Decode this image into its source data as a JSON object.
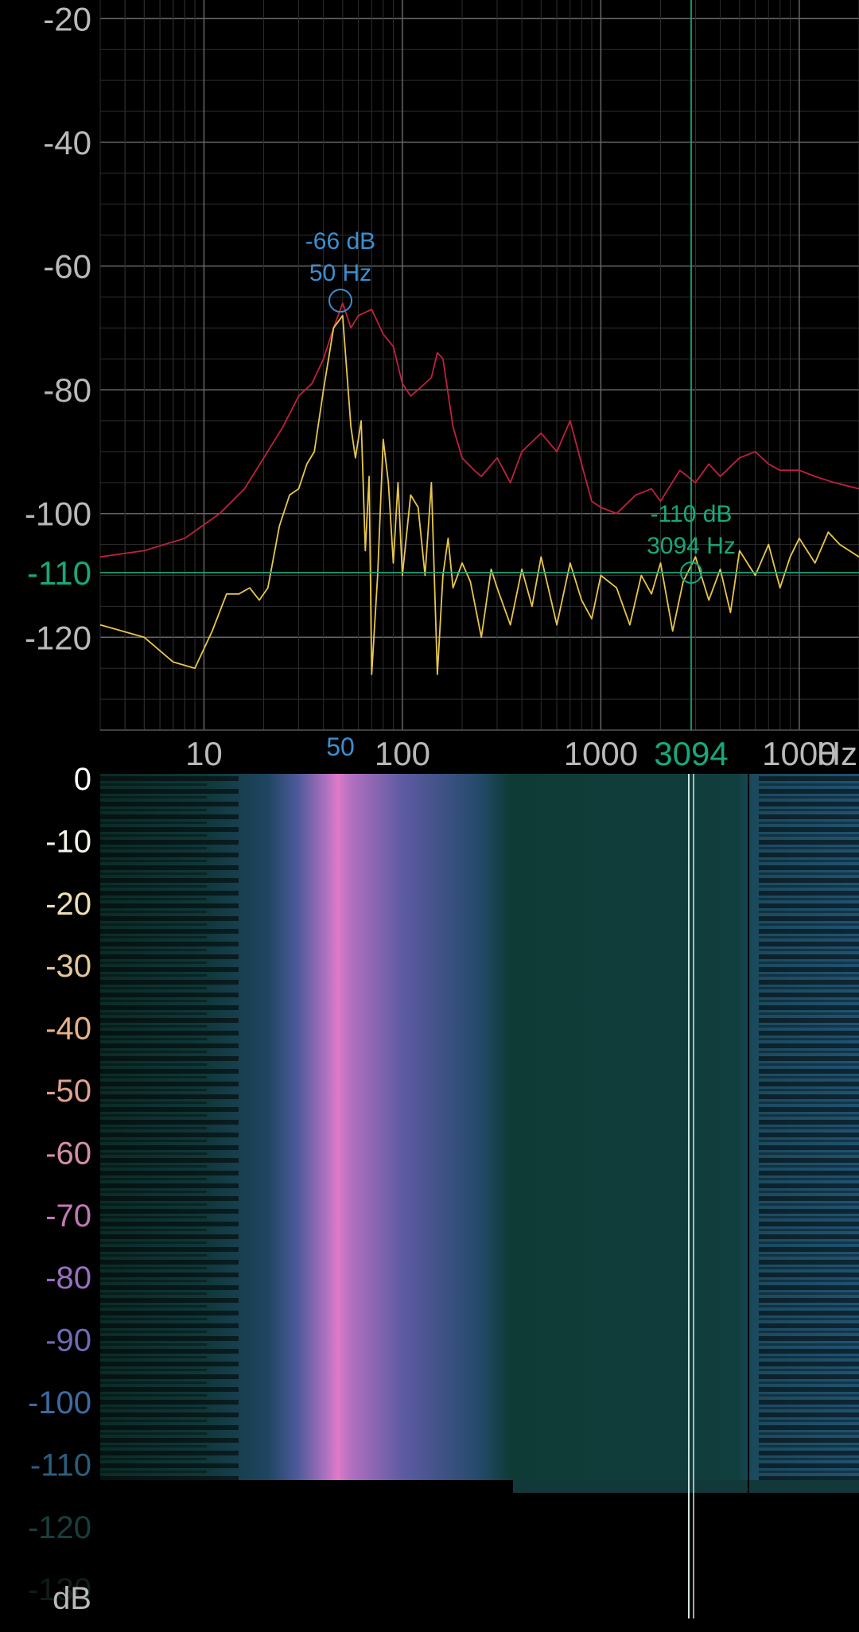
{
  "spectrum": {
    "y_ticks": [
      "-20",
      "-40",
      "-60",
      "-80",
      "-100",
      "-120"
    ],
    "x_ticks": [
      "10",
      "100",
      "1000",
      "1000"
    ],
    "x_unit": "Hz",
    "peak_marker": {
      "x_label": "50",
      "db_label": "-66 dB",
      "hz_label": "50 Hz"
    },
    "cursor": {
      "y_label": "-110",
      "x_label": "3094",
      "db_label": "-110 dB",
      "hz_label": "3094 Hz"
    }
  },
  "spectrogram": {
    "scale_labels": [
      "0",
      "-10",
      "-20",
      "-30",
      "-40",
      "-50",
      "-60",
      "-70",
      "-80",
      "-90",
      "-100",
      "-110",
      "-120",
      "-130"
    ],
    "scale_colors": [
      "#ffffff",
      "#f5f5ea",
      "#ede0b8",
      "#e4c89a",
      "#e7b28a",
      "#e0a090",
      "#d68ea8",
      "#c07ab6",
      "#9a6fc0",
      "#6f6bb6",
      "#3d6aa2",
      "#2b5d7c",
      "#173f3c",
      "#0e1e18"
    ],
    "unit": "dB"
  },
  "colors": {
    "background": "#000000",
    "grid": "#444444",
    "peak_hold_line": "#c0213e",
    "live_line": "#e8c64a",
    "cursor": "#17a87b",
    "peak_marker": "#3b8fd1"
  },
  "chart_data": {
    "type": "line",
    "x_scale": "log",
    "xlabel": "Hz",
    "ylabel": "",
    "xlim": [
      3,
      20000
    ],
    "ylim": [
      -135,
      -17
    ],
    "series": [
      {
        "x": [
          3,
          5,
          8,
          12,
          16,
          20,
          25,
          30,
          35,
          40,
          45,
          50,
          55,
          60,
          70,
          80,
          90,
          100,
          110,
          120,
          140,
          150,
          160,
          180,
          200,
          230,
          250,
          300,
          350,
          400,
          500,
          600,
          700,
          800,
          900,
          1000,
          1200,
          1500,
          1800,
          2000,
          2500,
          3000,
          3500,
          4000,
          5000,
          6000,
          7000,
          8000,
          10000,
          12000,
          15000,
          20000
        ],
        "y": [
          -107,
          -106,
          -104,
          -100,
          -96,
          -91,
          -86,
          -81,
          -79,
          -75,
          -70,
          -66,
          -70,
          -68,
          -67,
          -71,
          -73,
          -79,
          -81,
          -80,
          -78,
          -74,
          -75,
          -86,
          -91,
          -93,
          -94,
          -91,
          -95,
          -90,
          -87,
          -90,
          -85,
          -92,
          -98,
          -99,
          -100,
          -97,
          -96,
          -98,
          -93,
          -95,
          -92,
          -94,
          -91,
          -90,
          -92,
          -93,
          -93,
          -94,
          -95,
          -96
        ]
      },
      {
        "x": [
          3,
          5,
          7,
          9,
          11,
          13,
          15,
          17,
          19,
          21,
          24,
          27,
          30,
          33,
          36,
          40,
          45,
          50,
          55,
          58,
          62,
          65,
          68,
          70,
          75,
          80,
          85,
          90,
          95,
          100,
          110,
          120,
          130,
          140,
          150,
          160,
          170,
          180,
          200,
          220,
          250,
          280,
          300,
          350,
          400,
          450,
          500,
          600,
          700,
          800,
          900,
          1000,
          1200,
          1400,
          1600,
          1800,
          2000,
          2300,
          2600,
          3000,
          3500,
          4000,
          4500,
          5000,
          6000,
          7000,
          8000,
          9000,
          10000,
          12000,
          14000,
          16000,
          20000
        ],
        "y": [
          -118,
          -120,
          -124,
          -125,
          -119,
          -113,
          -113,
          -112,
          -114,
          -112,
          -102,
          -97,
          -96,
          -92,
          -90,
          -80,
          -70,
          -68,
          -86,
          -91,
          -85,
          -106,
          -94,
          -126,
          -110,
          -88,
          -95,
          -108,
          -95,
          -110,
          -97,
          -99,
          -110,
          -95,
          -126,
          -110,
          -104,
          -112,
          -108,
          -111,
          -120,
          -109,
          -112,
          -118,
          -109,
          -115,
          -107,
          -118,
          -108,
          -114,
          -117,
          -110,
          -112,
          -118,
          -110,
          -113,
          -108,
          -119,
          -111,
          -107,
          -114,
          -109,
          -116,
          -106,
          -110,
          -105,
          -112,
          -107,
          -104,
          -108,
          -103,
          -105,
          -107
        ]
      }
    ]
  }
}
